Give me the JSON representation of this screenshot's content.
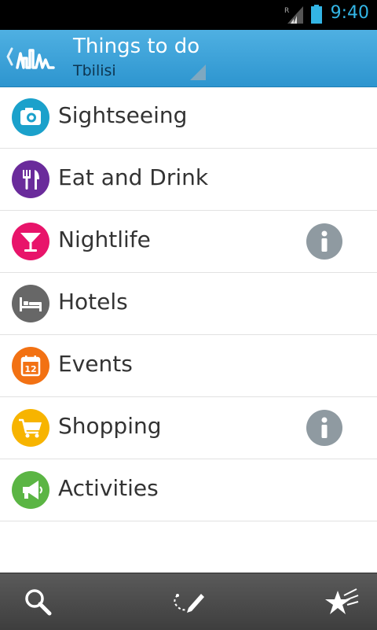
{
  "status_bar": {
    "time": "9:40",
    "roaming_indicator": "R"
  },
  "action_bar": {
    "title": "Things to do",
    "subtitle": "Tbilisi"
  },
  "categories": [
    {
      "label": "Sightseeing",
      "icon": "camera-icon",
      "color": "#1ba1cb",
      "has_info": false
    },
    {
      "label": "Eat and Drink",
      "icon": "fork-knife-icon",
      "color": "#6a2b9b",
      "has_info": false
    },
    {
      "label": "Nightlife",
      "icon": "cocktail-icon",
      "color": "#e8146a",
      "has_info": true
    },
    {
      "label": "Hotels",
      "icon": "bed-icon",
      "color": "#676767",
      "has_info": false
    },
    {
      "label": "Events",
      "icon": "calendar-icon",
      "color": "#f27113",
      "has_info": false
    },
    {
      "label": "Shopping",
      "icon": "cart-icon",
      "color": "#f7b400",
      "has_info": true
    },
    {
      "label": "Activities",
      "icon": "megaphone-icon",
      "color": "#5bb544",
      "has_info": false
    }
  ],
  "calendar_day": "12",
  "bottom_bar": {
    "items": [
      {
        "icon": "search-icon"
      },
      {
        "icon": "route-pencil-icon"
      },
      {
        "icon": "star-icon"
      }
    ]
  },
  "colors": {
    "action_bar": "#3aa2d9",
    "status_accent": "#33b5e5",
    "info_badge": "#8f9aa1"
  }
}
